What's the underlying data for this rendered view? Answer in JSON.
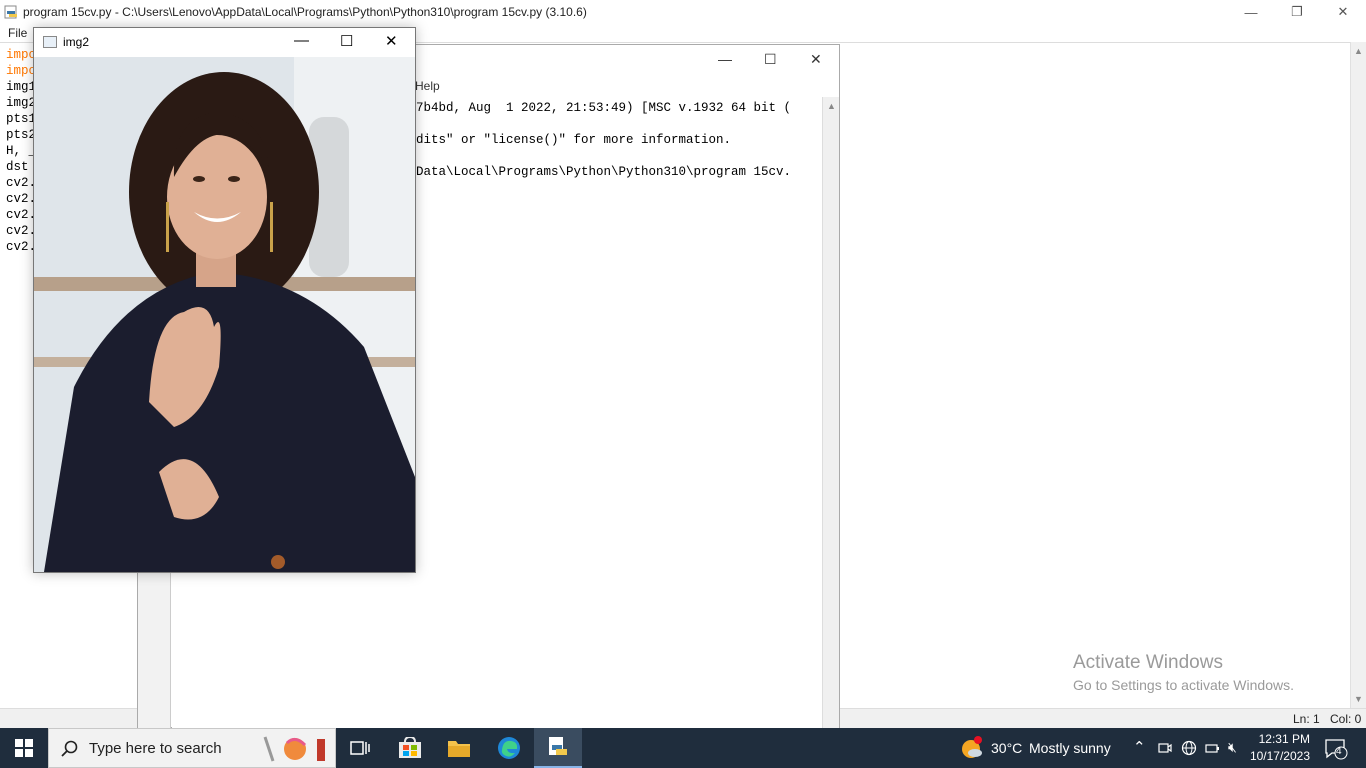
{
  "editor": {
    "title": "program 15cv.py - C:\\Users\\Lenovo\\AppData\\Local\\Programs\\Python\\Python310\\program 15cv.py (3.10.6)",
    "menu_file": "File",
    "code_lines": [
      "impo",
      "impo",
      "img1",
      "img2",
      "pts1",
      "pts2",
      "H, _",
      "dst ",
      "cv2.",
      "cv2.",
      "cv2.",
      "cv2.",
      "cv2."
    ],
    "status_ln": "Ln: 1",
    "status_col": "Col: 0"
  },
  "shell": {
    "menu_help": "Help",
    "lines": [
      "7b4bd, Aug  1 2022, 21:53:49) [MSC v.1932 64 bit (",
      "dits\" or \"license()\" for more information.",
      "Data\\Local\\Programs\\Python\\Python310\\program 15cv."
    ]
  },
  "imgwin": {
    "title": "img2"
  },
  "activate": {
    "line1": "Activate Windows",
    "line2": "Go to Settings to activate Windows."
  },
  "taskbar": {
    "search_placeholder": "Type here to search",
    "weather_temp": "30°C",
    "weather_desc": "Mostly sunny",
    "time": "12:31 PM",
    "date": "10/17/2023",
    "notification_count": "4"
  },
  "colors": {
    "keyword": "#ff7700",
    "taskbar_bg": "#1f2d3d",
    "accent": "#0078d7"
  }
}
